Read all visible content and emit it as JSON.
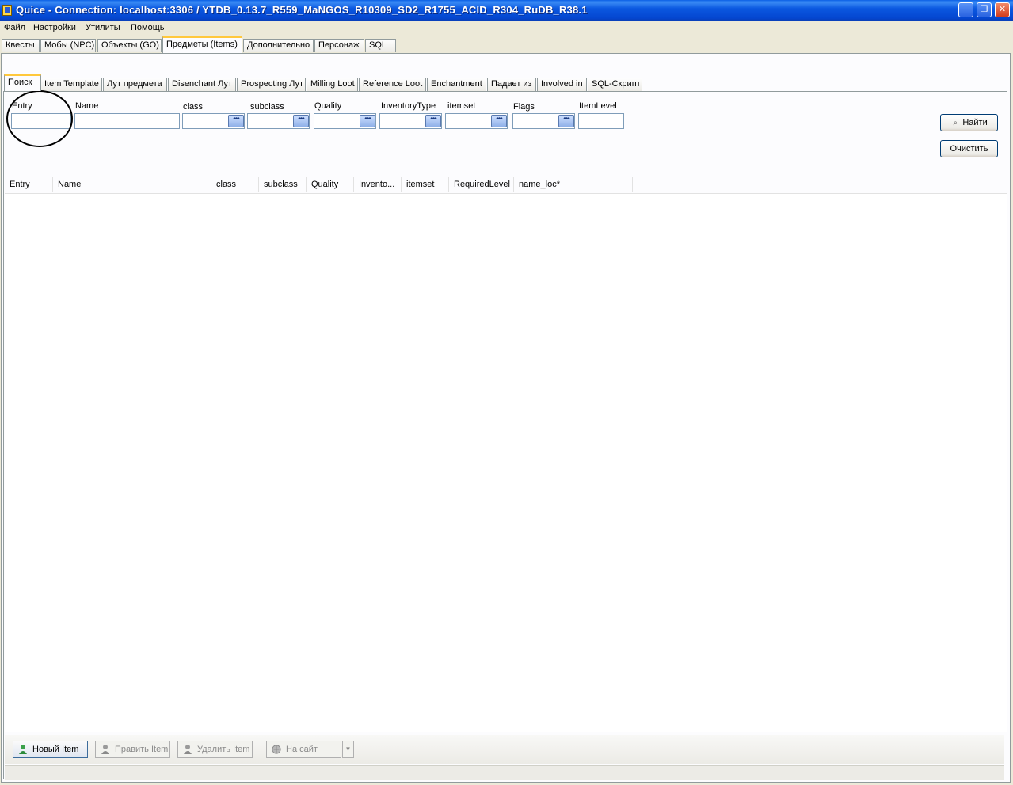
{
  "window": {
    "title": "Quice - Connection: localhost:3306 / YTDB_0.13.7_R559_MaNGOS_R10309_SD2_R1755_ACID_R304_RuDB_R38.1",
    "minimize": "_",
    "restore": "❐",
    "close": "✕"
  },
  "menu": [
    "Файл",
    "Настройки",
    "Утилиты",
    "Помощь"
  ],
  "main_tabs": [
    "Квесты",
    "Мобы (NPC)",
    "Объекты (GO)",
    "Предметы (Items)",
    "Дополнительно",
    "Персонаж",
    "SQL"
  ],
  "main_tab_active": "Предметы (Items)",
  "sub_tabs": [
    "Поиск",
    "Item Template",
    "Лут предмета",
    "Disenchant Лут",
    "Prospecting Лут",
    "Milling Loot",
    "Reference Loot",
    "Enchantment",
    "Падает из",
    "Involved in",
    "SQL-Скрипт"
  ],
  "sub_tab_active": "Поиск",
  "search": {
    "labels": {
      "entry": "Entry",
      "name": "Name",
      "class": "class",
      "subclass": "subclass",
      "quality": "Quality",
      "inventory_type": "InventoryType",
      "itemset": "itemset",
      "flags": "Flags",
      "item_level": "ItemLevel"
    },
    "values": {
      "entry": "",
      "name": "",
      "class": "",
      "subclass": "",
      "quality": "",
      "inventory_type": "",
      "itemset": "",
      "flags": "",
      "item_level": ""
    },
    "picker_glyph": "•••",
    "find_button": "Найти",
    "clear_button": "Очистить"
  },
  "results": {
    "columns": [
      "Entry",
      "Name",
      "class",
      "subclass",
      "Quality",
      "Invento...",
      "itemset",
      "RequiredLevel",
      "name_loc*"
    ],
    "rows": []
  },
  "toolbar": {
    "new_item": "Новый Item",
    "edit_item": "Править Item",
    "delete_item": "Удалить Item",
    "to_site": "На сайт",
    "dropdown_arrow": "▼"
  },
  "colors": {
    "titlebar": "#0a5fe5",
    "active_tab_accent": "#ffc83c",
    "panel_bg": "#fcfcfe"
  }
}
